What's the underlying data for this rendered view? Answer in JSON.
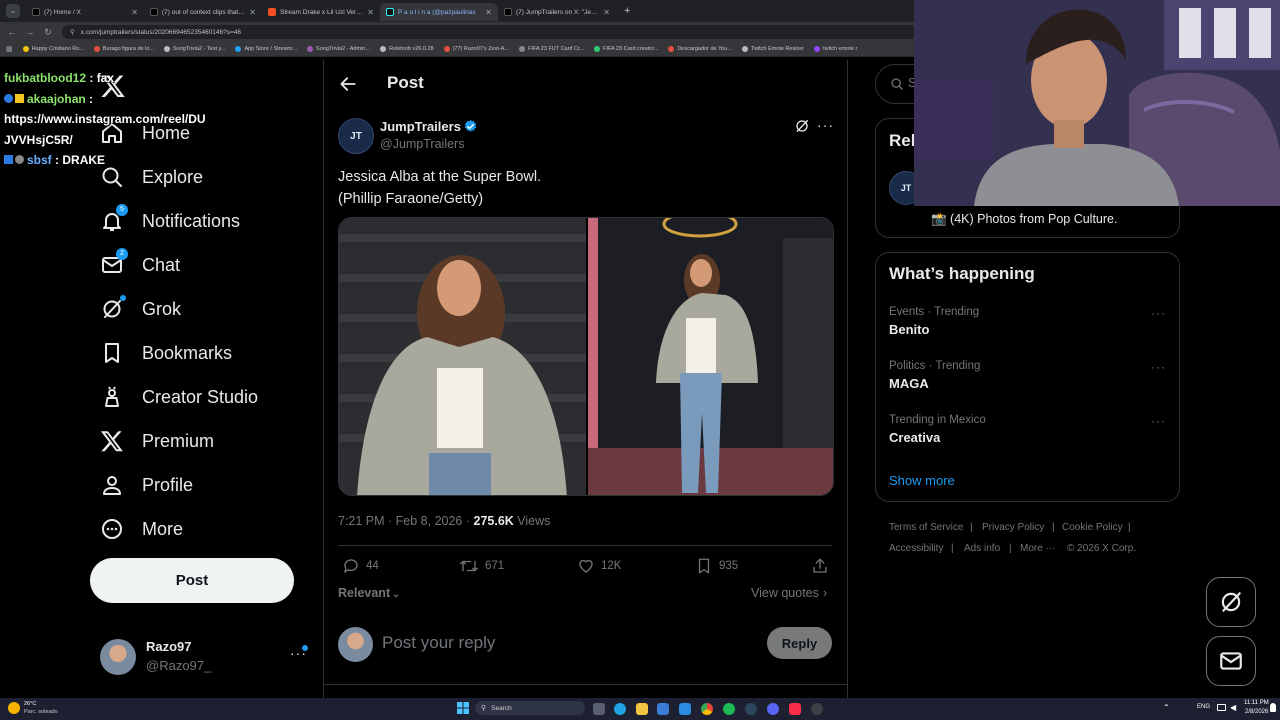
{
  "browser": {
    "tabs": [
      {
        "title": "(7) Home / X",
        "color": "#e8eaed"
      },
      {
        "title": "(7) out of context clips that go",
        "color": "#e8eaed"
      },
      {
        "title": "Stream Drake x Lil Uzi Vert - Al",
        "color": "#f25022"
      },
      {
        "title": "P a u l i n a (@pazpaulinas",
        "color": "#e8eaed"
      },
      {
        "title": "(7) JumpTrailers on X: \"Jessica A",
        "color": "#e8eaed"
      }
    ],
    "url": "x.com/jumptrailers/status/2020669465235460146?s=46",
    "bookmarks": [
      "Happy Cristiano Ro...",
      "Burago figura de lo...",
      "SongTrivia2 - Test y...",
      "App Store / Streami...",
      "SongTrivia2 - Admin...",
      "Reletoob v26.0.28",
      "(77) Razo97's Zest-A...",
      "FIFA 23 FUT Card Cr...",
      "FIFA 23 Card creator...",
      "Descargador de You...",
      "Twitch Emote Resizer",
      "twitch emote r"
    ]
  },
  "chat_overlay": {
    "line1_user": "fukbatblood12",
    "line1_sep": " : ",
    "line1_msg": "fax",
    "line2_user": "akaajohan",
    "line2_sep": " :",
    "line3": "https://www.instagram.com/reel/DU",
    "line4": "JVVHsjC5R/",
    "line5_user": "sbsf",
    "line5_sep": " : ",
    "line5_msg": "DRAKE"
  },
  "nav": {
    "home": "Home",
    "explore": "Explore",
    "notifications": "Notifications",
    "notifications_badge": "5",
    "chat": "Chat",
    "chat_badge": "2",
    "grok": "Grok",
    "bookmarks": "Bookmarks",
    "creator_studio": "Creator Studio",
    "premium": "Premium",
    "profile": "Profile",
    "more": "More",
    "post_button": "Post"
  },
  "account": {
    "name": "Razo97",
    "handle": "@Razo97_"
  },
  "header": {
    "title": "Post"
  },
  "tweet": {
    "avatar_text": "JT",
    "author": "JumpTrailers",
    "handle": "@JumpTrailers",
    "text_line1": "Jessica Alba at the Super Bowl.",
    "text_line2": "(Phillip Faraone/Getty)",
    "time": "7:21 PM · Feb 8, 2026 · ",
    "views_count": "275.6K",
    "views_label": " Views",
    "replies": "44",
    "reposts": "671",
    "likes": "12K",
    "bookmarks": "935",
    "sort": "Relevant",
    "view_quotes": "View quotes"
  },
  "reply": {
    "placeholder": "Post your reply",
    "button": "Reply"
  },
  "right": {
    "search_placeholder": "Se",
    "relevant_heading": "Rel",
    "relevant_avatar": "JT",
    "relevant_desc": "📸 (4K) Photos from Pop Culture.",
    "happening_title": "What’s happening",
    "trends": [
      {
        "category": "Events · Trending",
        "name": "Benito"
      },
      {
        "category": "Politics · Trending",
        "name": "MAGA"
      },
      {
        "category": "Trending in Mexico",
        "name": "Creativa"
      }
    ],
    "show_more": "Show more",
    "footer": [
      "Terms of Service",
      "|",
      "Privacy Policy",
      "|",
      "Cookie Policy",
      "|",
      "Accessibility",
      "|",
      "Ads info",
      "|",
      "More ···",
      "© 2026 X Corp."
    ]
  },
  "taskbar": {
    "weather_temp": "26°C",
    "weather_desc": "Parc. soleado",
    "search": "Search",
    "lang": "ENG",
    "time": "11:11 PM",
    "date": "2/8/2026"
  },
  "colors": {
    "accent": "#1d9bf0",
    "verified": "#1d9bf0",
    "bg": "#000000",
    "text": "#e7e9ea",
    "muted": "#71767b"
  }
}
